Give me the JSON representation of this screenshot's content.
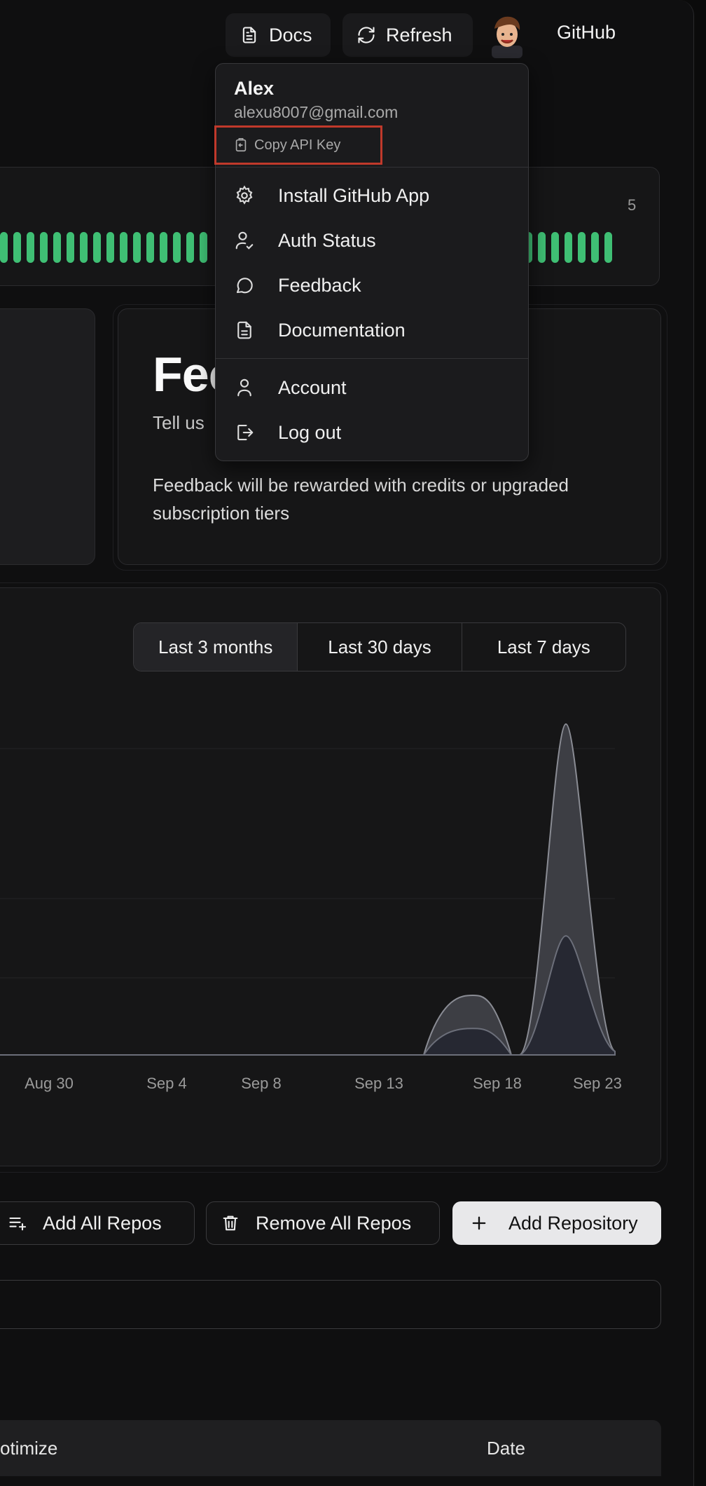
{
  "topbar": {
    "docs_label": "Docs",
    "refresh_label": "Refresh",
    "github_label": "GitHub"
  },
  "activity": {
    "count": "5"
  },
  "feedback_card": {
    "title": "Fee",
    "subtitle": "Tell us",
    "description": "Feedback will be rewarded with credits or upgraded subscription tiers"
  },
  "range": {
    "options": [
      "Last 3 months",
      "Last 30 days",
      "Last 7 days"
    ],
    "selected": "Last 3 months"
  },
  "chart_data": {
    "type": "area",
    "x": [
      "Aug 30",
      "Sep 4",
      "Sep 8",
      "Sep 13",
      "Sep 18",
      "Sep 23"
    ],
    "series": [
      {
        "values": [
          0,
          0,
          0,
          0,
          18,
          100
        ]
      },
      {
        "values": [
          0,
          0,
          0,
          0,
          8,
          36
        ]
      }
    ],
    "grid": true
  },
  "actions": {
    "add_all": "Add All Repos",
    "remove_all": "Remove All Repos",
    "add_repo": "Add Repository"
  },
  "table": {
    "col_optimize": "otimize",
    "col_date": "Date"
  },
  "dropdown": {
    "name": "Alex",
    "email": "alexu8007@gmail.com",
    "copy_api": "Copy API Key",
    "items": [
      "Install GitHub App",
      "Auth Status",
      "Feedback",
      "Documentation",
      "Account",
      "Log out"
    ]
  },
  "colors": {
    "accent_green": "#3fbf74",
    "highlight_red": "#c0392b"
  }
}
